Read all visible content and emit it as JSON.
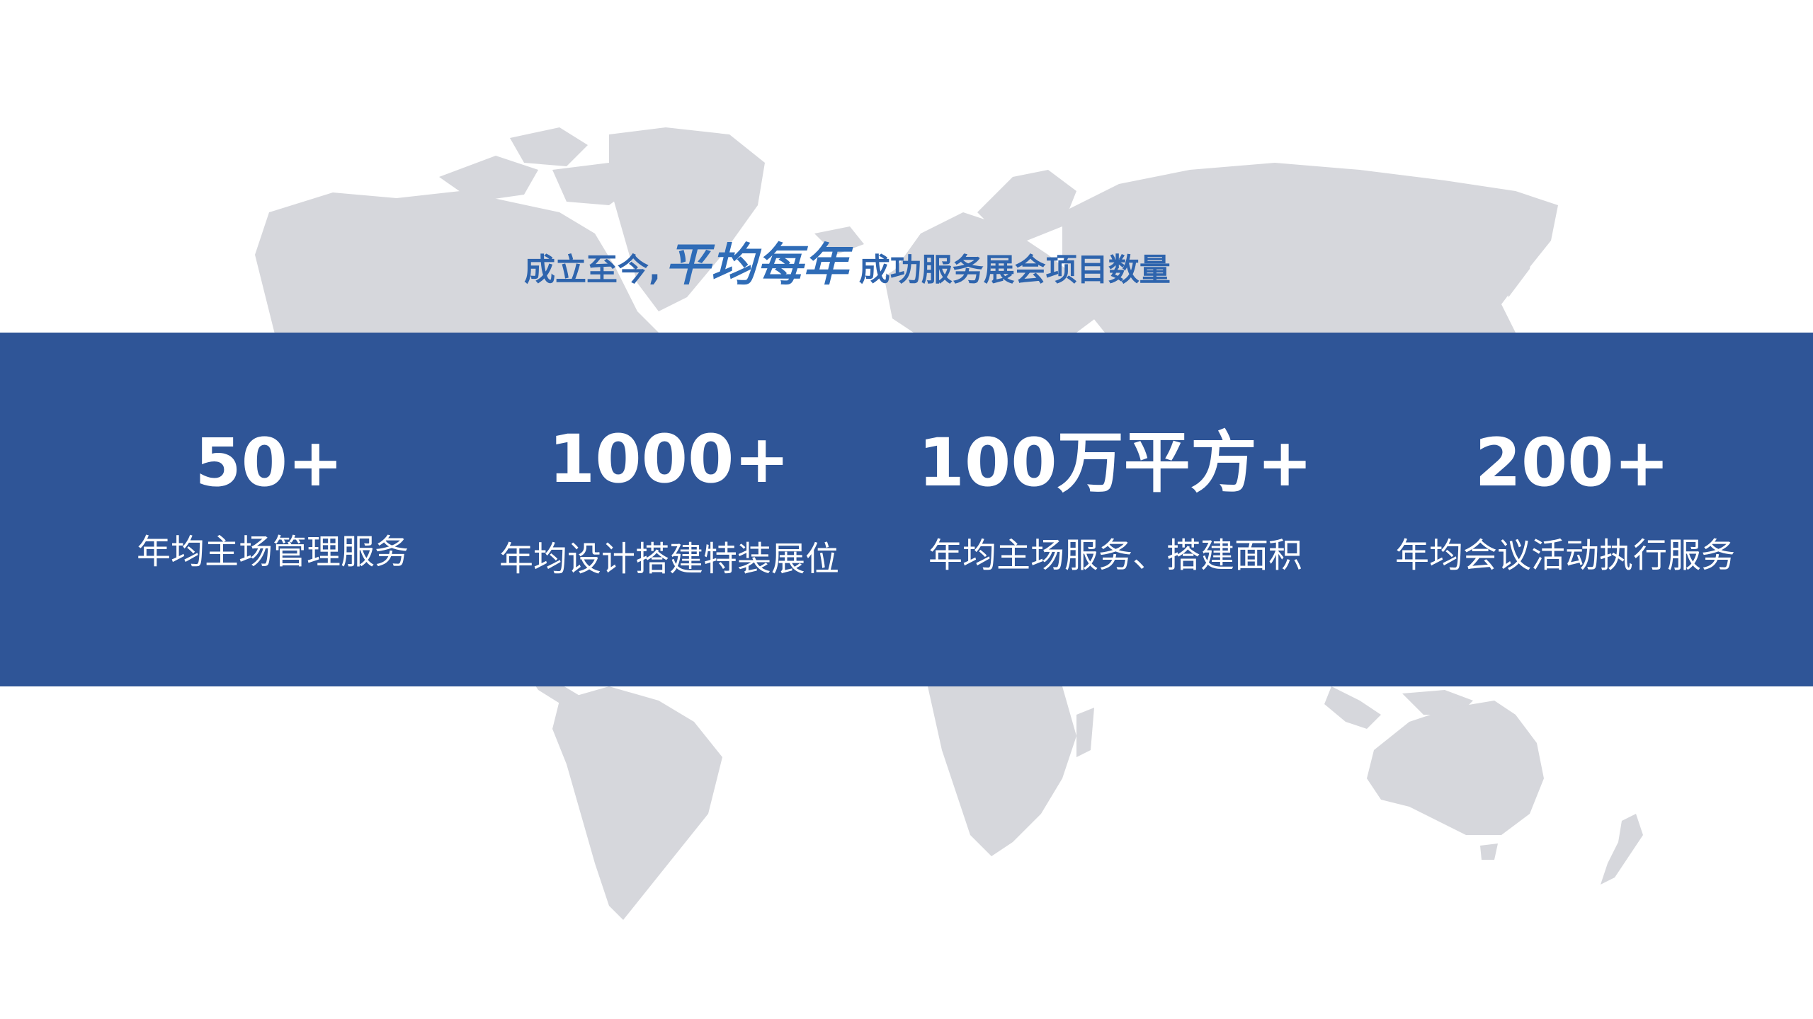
{
  "header": {
    "prefix": "成立至今,",
    "emphasis": "平均每年",
    "suffix": "成功服务展会项目数量"
  },
  "stats": [
    {
      "value": "50+",
      "label": "年均主场管理服务"
    },
    {
      "value": "1000+",
      "label": "年均设计搭建特装展位"
    },
    {
      "value": "100万平方+",
      "label": "年均主场服务、搭建面积"
    },
    {
      "value": "200+",
      "label": "年均会议活动执行服务"
    }
  ],
  "colors": {
    "band": "#2f5597",
    "headline": "#2e64ad",
    "map": "#d6d7dc"
  },
  "icons": {
    "background": "world-map-icon"
  }
}
